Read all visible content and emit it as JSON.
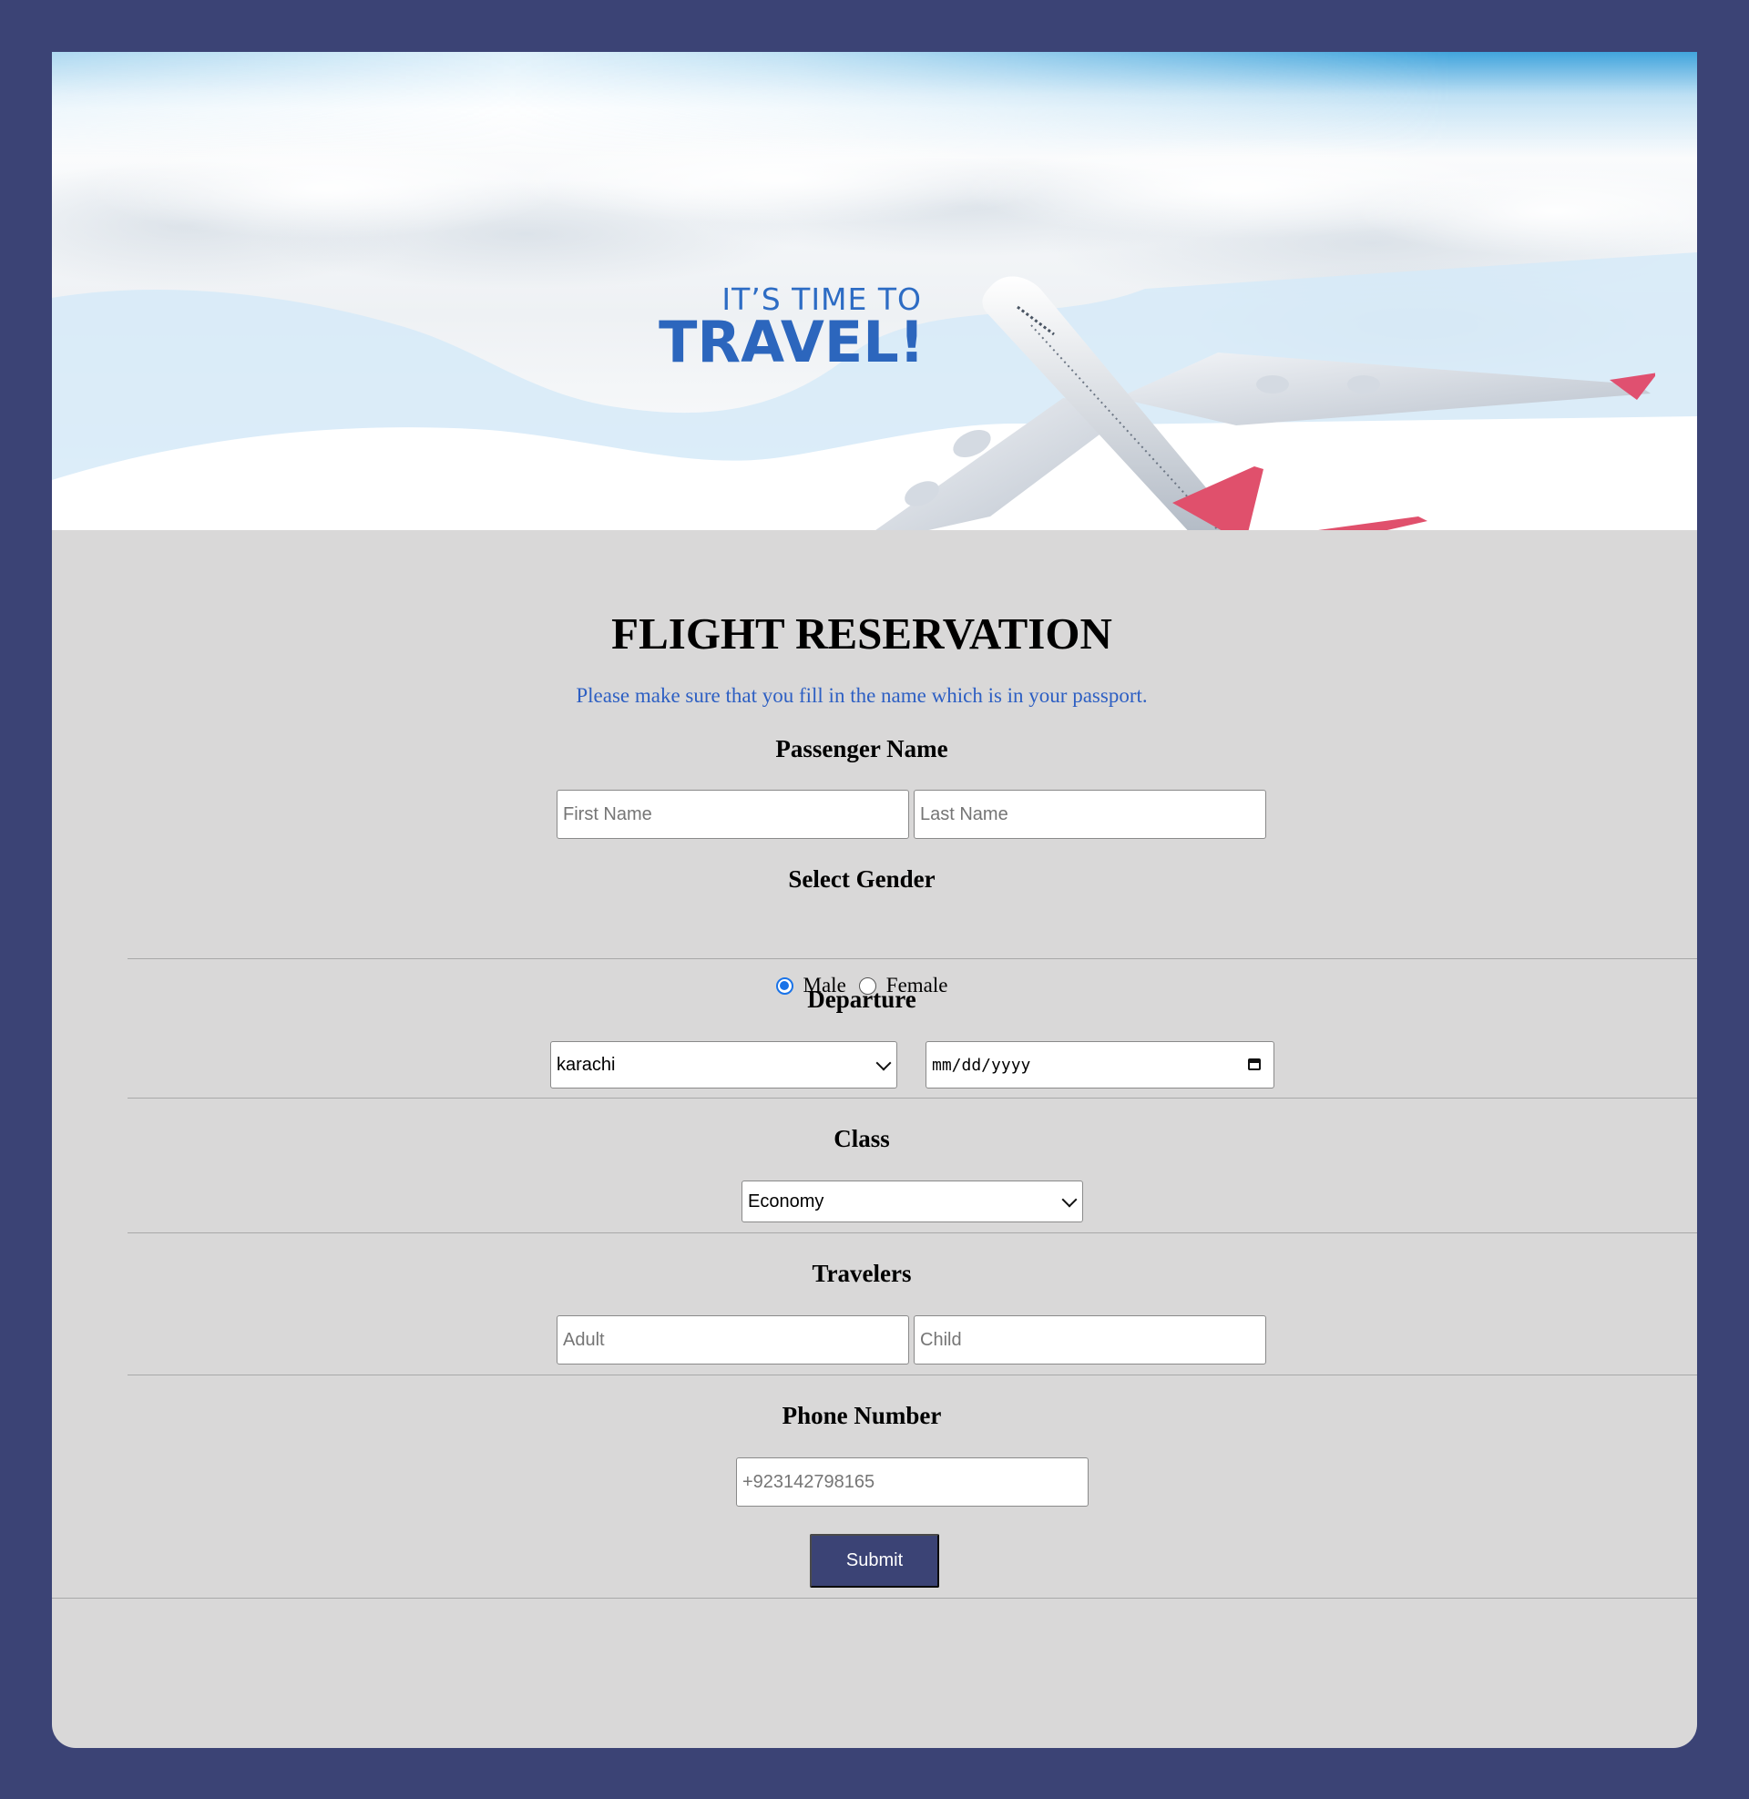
{
  "hero": {
    "line1": "IT’S TIME TO",
    "line2": "TRAVEL!"
  },
  "form": {
    "title": "FLIGHT RESERVATION",
    "subtitle": "Please make sure that you fill in the name which is in your passport.",
    "passenger": {
      "label": "Passenger Name",
      "first_placeholder": "First Name",
      "last_placeholder": "Last Name"
    },
    "gender": {
      "label": "Select Gender",
      "options": [
        "Male",
        "Female"
      ],
      "selected": "Male"
    },
    "departure": {
      "label": "Departure",
      "city_value": "karachi",
      "date_placeholder": "mm/dd/yyyy"
    },
    "class": {
      "label": "Class",
      "value": "Economy"
    },
    "travelers": {
      "label": "Travelers",
      "adult_placeholder": "Adult",
      "child_placeholder": "Child"
    },
    "phone": {
      "label": "Phone Number",
      "placeholder": "+923142798165"
    },
    "submit_label": "Submit"
  },
  "colors": {
    "page_background": "#3b4375",
    "card_background": "#d9d8d8",
    "subtitle_text": "#2d5fc3",
    "button_background": "#3b4375",
    "radio_accent": "#1a73e8"
  },
  "icons": {
    "select_arrow": "chevron-down-icon",
    "date_picker": "calendar-icon"
  }
}
